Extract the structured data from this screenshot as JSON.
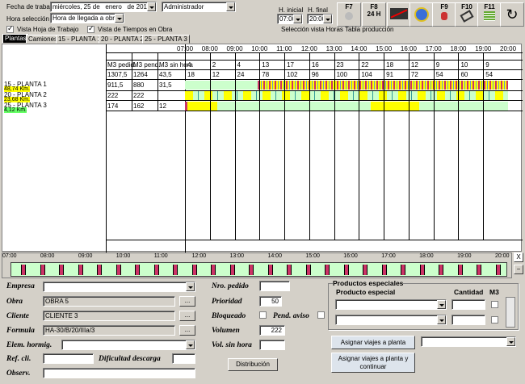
{
  "header": {
    "fecha_label": "Fecha de trabajo",
    "fecha_day": "miércoles, 25 de",
    "fecha_month": "enero",
    "fecha_year": "de 2012",
    "user": "Administrador",
    "hora_sel_label": "Hora selección",
    "hora_sel_value": "Hora de llegada a obra",
    "vista_hoja": "Vista Hoja de Trabajo",
    "vista_tiempos": "Vista de Tiempos en Obra",
    "h_inicial_label": "H. inicial",
    "h_inicial": "07:00",
    "h_final_label": "H. final",
    "h_final": "20:00",
    "seleccion_text": "Selección vista Horas Tabla producción"
  },
  "toolbar": {
    "f7": "F7",
    "f8": "F8",
    "f8sub": "24 H",
    "f9": "F9",
    "f10": "F10",
    "f11": "F11"
  },
  "tabs": [
    "Plantas",
    "Camiones",
    "15 - PLANTA 1",
    "20 - PLANTA 2",
    "25 - PLANTA 3"
  ],
  "grid": {
    "times": [
      "07:00",
      "08:00",
      "09:00",
      "10:00",
      "11:00",
      "12:00",
      "13:00",
      "14:00",
      "15:00",
      "16:00",
      "17:00",
      "18:00",
      "19:00",
      "20:00"
    ],
    "col_heads": [
      "M3 pedid.",
      "M3 pend.",
      "M3 sin hora"
    ],
    "totals": [
      "1307,5",
      "1264",
      "43,5"
    ],
    "row_a": [
      "4",
      "2",
      "4",
      "13",
      "17",
      "16",
      "23",
      "22",
      "18",
      "12",
      "9",
      "10",
      "9"
    ],
    "row_b": [
      "18",
      "12",
      "24",
      "78",
      "102",
      "96",
      "100",
      "104",
      "91",
      "72",
      "54",
      "60",
      "54"
    ],
    "plants": [
      {
        "name": "15 - PLANTA 1",
        "km": "48,74 Km.",
        "v": [
          "911,5",
          "880",
          "31,5"
        ]
      },
      {
        "name": "20 - PLANTA 2",
        "km": "23,68 Km.",
        "v": [
          "222",
          "222",
          ""
        ]
      },
      {
        "name": "25 - PLANTA 3",
        "km": "4,12 Km.",
        "v": [
          "174",
          "162",
          "12"
        ]
      }
    ]
  },
  "timeline": {
    "times": [
      "07:00",
      "08:00",
      "09:00",
      "10:00",
      "11:00",
      "12:00",
      "13:00",
      "14:00",
      "15:00",
      "16:00",
      "17:00",
      "18:00",
      "19:00",
      "20:00"
    ]
  },
  "form": {
    "empresa": "Empresa",
    "obra": "Obra",
    "obra_val": "OBRA 5",
    "cliente": "Cliente",
    "cliente_val": "CLIENTE 3",
    "formula": "Formula",
    "formula_val": "HA-30/B/20/IIIa/3",
    "elem": "Elem. hormig.",
    "refcli": "Ref. cli.",
    "dificultad": "Dificultad descarga",
    "observ": "Observ.",
    "nro_pedido": "Nro. pedido",
    "prioridad": "Prioridad",
    "prioridad_val": "50",
    "bloqueado": "Bloqueado",
    "pend_aviso": "Pend. aviso",
    "volumen": "Volumen",
    "volumen_val": "222",
    "vol_sin_hora": "Vol. sin hora",
    "distribucion": "Distribución",
    "dots": "...",
    "productos_title": "Productos especiales",
    "producto_col": "Producto especial",
    "cantidad_col": "Cantidad",
    "m3_col": "M3",
    "asignar": "Asignar viajes a planta",
    "asignar_continuar": "Asignar viajes a planta y continuar",
    "close_x": "X"
  },
  "colors": {
    "green": "#ccffcc",
    "yellow": "#ffff00",
    "pink": "#cc3366",
    "lblgreen": "#66ff66",
    "lblyellow": "#ffff00"
  }
}
